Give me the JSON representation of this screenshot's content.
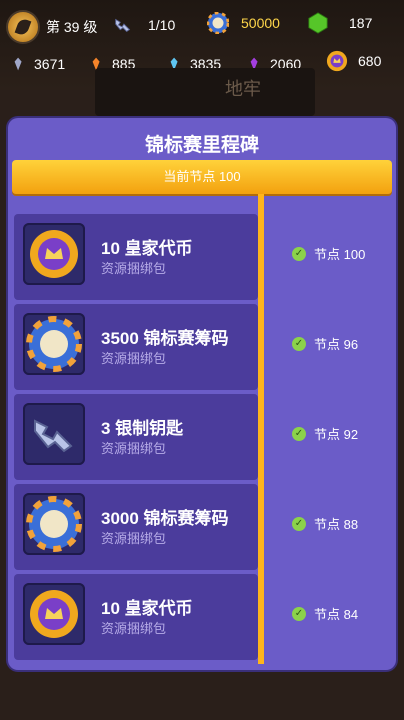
{
  "topbar": {
    "level": "第 39 级",
    "keys": "1/10",
    "chips": "50000",
    "gems": "187",
    "resources": [
      "3671",
      "885",
      "3835",
      "2060",
      "680"
    ]
  },
  "background_text": "地牢",
  "panel": {
    "title": "锦标赛里程碑",
    "current_node": "当前节点 100",
    "rewards": [
      {
        "name": "10 皇家代币",
        "sub": "资源捆绑包",
        "node": "节点 100",
        "icon": "royal-token-icon"
      },
      {
        "name": "3500 锦标赛筹码",
        "sub": "资源捆绑包",
        "node": "节点 96",
        "icon": "tournament-chip-icon"
      },
      {
        "name": "3 银制钥匙",
        "sub": "资源捆绑包",
        "node": "节点 92",
        "icon": "silver-key-icon"
      },
      {
        "name": "3000 锦标赛筹码",
        "sub": "资源捆绑包",
        "node": "节点 88",
        "icon": "tournament-chip-icon"
      },
      {
        "name": "10 皇家代币",
        "sub": "资源捆绑包",
        "node": "节点 84",
        "icon": "royal-token-icon"
      }
    ]
  },
  "colors": {
    "panel": "#6b5cc8",
    "header": "#ffc524",
    "row": "#4b3c9c"
  }
}
